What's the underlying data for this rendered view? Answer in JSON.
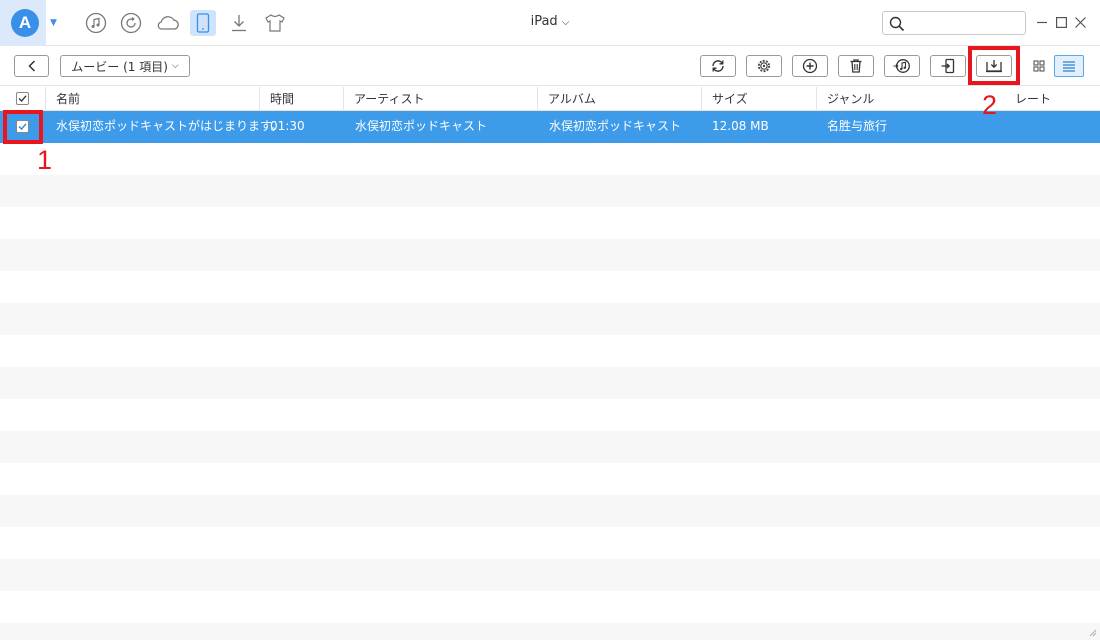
{
  "app": {
    "logo_letter": "A",
    "device_name": "iPad",
    "device_chevron": "⌄"
  },
  "topnav": [
    {
      "name": "music-icon"
    },
    {
      "name": "restore-icon"
    },
    {
      "name": "cloud-icon"
    },
    {
      "name": "device-icon",
      "active": true
    },
    {
      "name": "download-icon"
    },
    {
      "name": "tshirt-icon"
    }
  ],
  "search": {
    "placeholder": "",
    "value": ""
  },
  "window_controls": [
    "minimize-icon",
    "maximize-icon",
    "close-icon"
  ],
  "toolbar": {
    "breadcrumb": "ムービー (1 項目)",
    "actions": [
      "refresh-icon",
      "settings-icon",
      "add-icon",
      "delete-icon",
      "to-itunes-icon",
      "to-device-icon",
      "to-computer-icon"
    ],
    "view_modes": [
      "grid-view-icon",
      "list-view-icon"
    ],
    "active_view": "list"
  },
  "table": {
    "columns": [
      "名前",
      "時間",
      "アーティスト",
      "アルバム",
      "サイズ",
      "ジャンル",
      "レート"
    ],
    "rows": [
      {
        "checked": true,
        "selected": true,
        "name": "水俣初恋ポッドキャストがはじまります。",
        "time": "01:30",
        "artist": "水俣初恋ポッドキャスト",
        "album": "水俣初恋ポッドキャスト",
        "size": "12.08 MB",
        "genre": "名胜与旅行",
        "rating": ""
      }
    ]
  },
  "annotations": [
    {
      "label": "1",
      "target": "row-checkbox"
    },
    {
      "label": "2",
      "target": "to-computer-button"
    }
  ],
  "colors": {
    "accent": "#3d9be9",
    "highlight": "#e8161c",
    "stripe": "#f7f7f7",
    "logo": "#3a8fe8"
  }
}
